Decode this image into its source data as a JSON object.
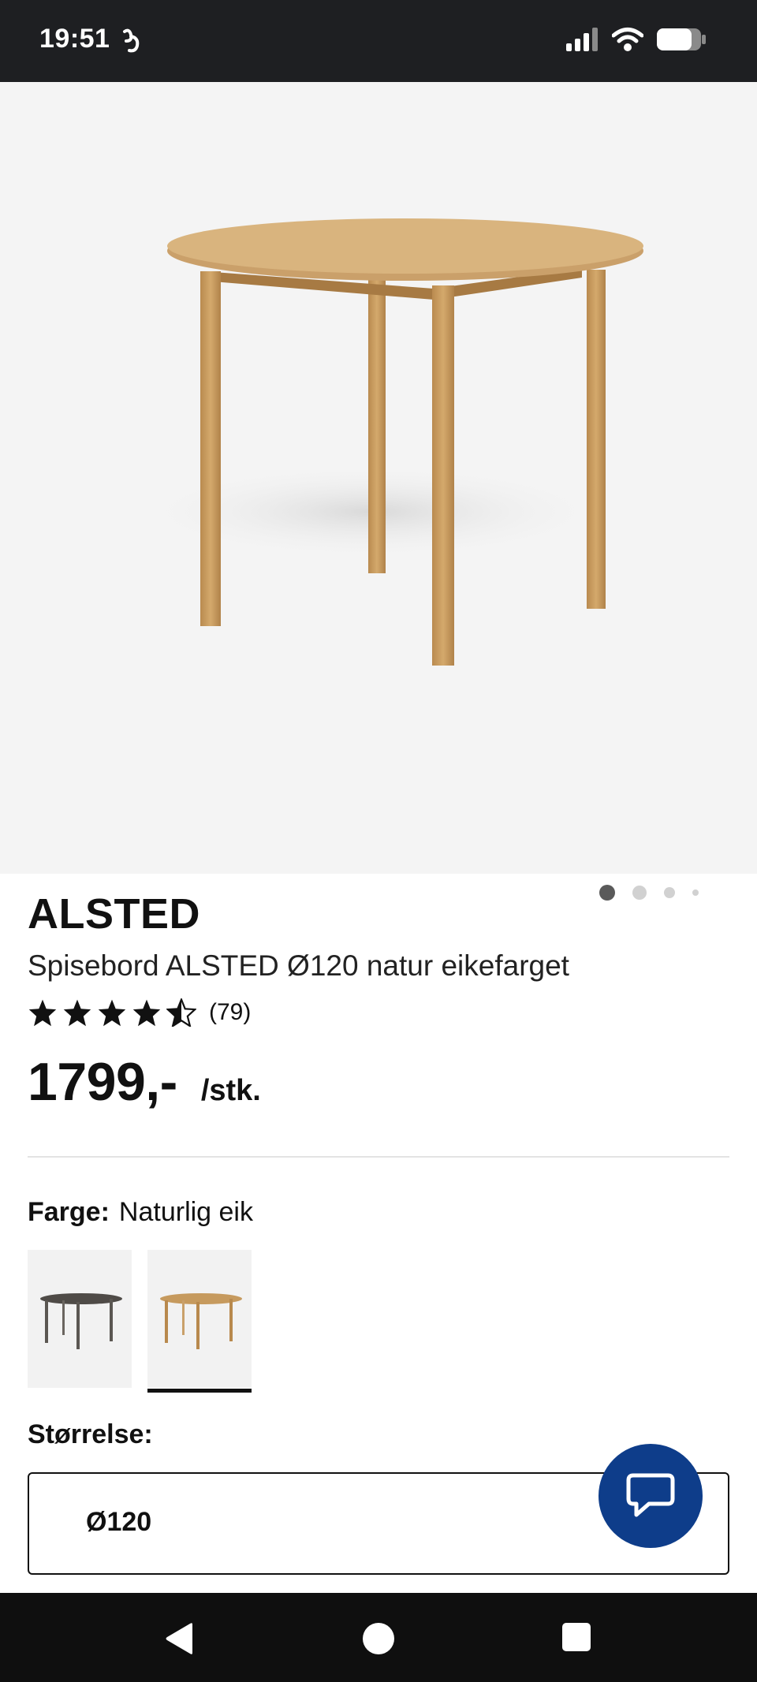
{
  "status_bar": {
    "time": "19:51",
    "icons": [
      "app-notification-icon",
      "signal-icon",
      "wifi-icon",
      "battery-icon"
    ]
  },
  "carousel": {
    "dot_count": 4,
    "active_index": 0
  },
  "product": {
    "name": "ALSTED",
    "description": "Spisebord ALSTED Ø120 natur eikefarget",
    "rating": 4.5,
    "review_count": "(79)",
    "price": "1799,-",
    "unit": "/stk."
  },
  "color": {
    "label": "Farge:",
    "value": "Naturlig eik",
    "swatches": [
      {
        "name": "grey",
        "color": "#5b5752",
        "selected": false
      },
      {
        "name": "natural-oak",
        "color": "#c69a5e",
        "selected": true
      }
    ]
  },
  "size": {
    "label": "Størrelse:",
    "value": "Ø120"
  },
  "colors": {
    "chat_button": "#0e3d8a",
    "status_bar": "#1e1f22",
    "nav_bar": "#0f0f0f"
  },
  "nav": [
    "back-icon",
    "home-icon",
    "recents-icon"
  ]
}
